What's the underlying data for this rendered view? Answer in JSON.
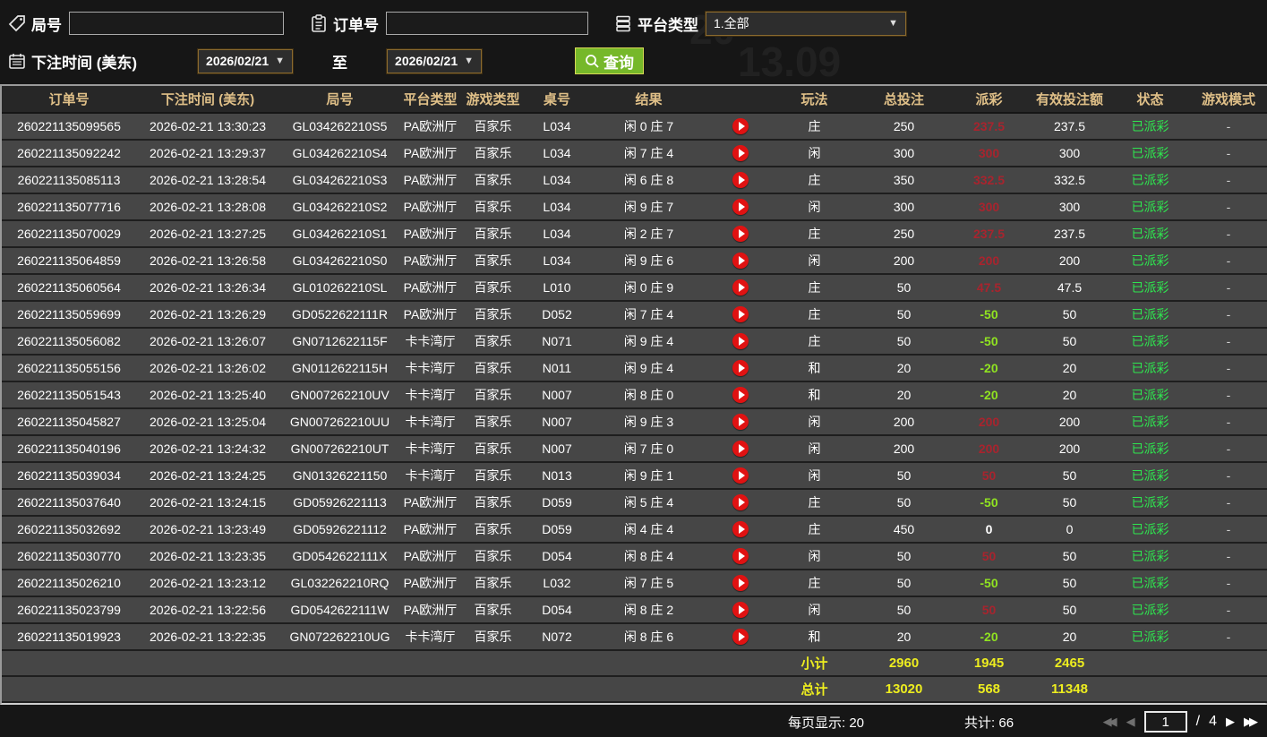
{
  "watermark": {
    "part1": "20",
    "part2": "13.09"
  },
  "filters": {
    "game_no_label": "局号",
    "order_no_label": "订单号",
    "platform_label": "平台类型",
    "platform_value": "1.全部",
    "bet_time_label": "下注时间 (美东)",
    "date_from": "2026/02/21",
    "to_label": "至",
    "date_to": "2026/02/21",
    "query_label": "查询",
    "caret": "▼"
  },
  "colors": {
    "payout_win": "#a8242e",
    "payout_loss": "#90e321",
    "status_paid_green": "#2ee64f",
    "summary_yellow": "#eded1f",
    "header_gold": "#e0c088",
    "query_button_green": "#76b82a",
    "play_icon_red": "#e01212"
  },
  "table": {
    "columns": [
      "订单号",
      "下注时间 (美东)",
      "局号",
      "平台类型",
      "游戏类型",
      "桌号",
      "结果",
      "",
      "玩法",
      "总投注",
      "派彩",
      "有效投注额",
      "状态",
      "游戏模式"
    ],
    "rows": [
      {
        "order": "260221135099565",
        "time": "2026-02-21 13:30:23",
        "game_no": "GL034262210S5",
        "platform": "PA欧洲厅",
        "game_type": "百家乐",
        "table_no": "L034",
        "result": "闲 0 庄 7",
        "bet_type": "庄",
        "total_bet": "250",
        "payout": "237.5",
        "payout_sign": "pos",
        "valid_bet": "237.5",
        "status": "已派彩",
        "mode": "-"
      },
      {
        "order": "260221135092242",
        "time": "2026-02-21 13:29:37",
        "game_no": "GL034262210S4",
        "platform": "PA欧洲厅",
        "game_type": "百家乐",
        "table_no": "L034",
        "result": "闲 7 庄 4",
        "bet_type": "闲",
        "total_bet": "300",
        "payout": "300",
        "payout_sign": "pos",
        "valid_bet": "300",
        "status": "已派彩",
        "mode": "-"
      },
      {
        "order": "260221135085113",
        "time": "2026-02-21 13:28:54",
        "game_no": "GL034262210S3",
        "platform": "PA欧洲厅",
        "game_type": "百家乐",
        "table_no": "L034",
        "result": "闲 6 庄 8",
        "bet_type": "庄",
        "total_bet": "350",
        "payout": "332.5",
        "payout_sign": "pos",
        "valid_bet": "332.5",
        "status": "已派彩",
        "mode": "-"
      },
      {
        "order": "260221135077716",
        "time": "2026-02-21 13:28:08",
        "game_no": "GL034262210S2",
        "platform": "PA欧洲厅",
        "game_type": "百家乐",
        "table_no": "L034",
        "result": "闲 9 庄 7",
        "bet_type": "闲",
        "total_bet": "300",
        "payout": "300",
        "payout_sign": "pos",
        "valid_bet": "300",
        "status": "已派彩",
        "mode": "-"
      },
      {
        "order": "260221135070029",
        "time": "2026-02-21 13:27:25",
        "game_no": "GL034262210S1",
        "platform": "PA欧洲厅",
        "game_type": "百家乐",
        "table_no": "L034",
        "result": "闲 2 庄 7",
        "bet_type": "庄",
        "total_bet": "250",
        "payout": "237.5",
        "payout_sign": "pos",
        "valid_bet": "237.5",
        "status": "已派彩",
        "mode": "-"
      },
      {
        "order": "260221135064859",
        "time": "2026-02-21 13:26:58",
        "game_no": "GL034262210S0",
        "platform": "PA欧洲厅",
        "game_type": "百家乐",
        "table_no": "L034",
        "result": "闲 9 庄 6",
        "bet_type": "闲",
        "total_bet": "200",
        "payout": "200",
        "payout_sign": "pos",
        "valid_bet": "200",
        "status": "已派彩",
        "mode": "-"
      },
      {
        "order": "260221135060564",
        "time": "2026-02-21 13:26:34",
        "game_no": "GL010262210SL",
        "platform": "PA欧洲厅",
        "game_type": "百家乐",
        "table_no": "L010",
        "result": "闲 0 庄 9",
        "bet_type": "庄",
        "total_bet": "50",
        "payout": "47.5",
        "payout_sign": "pos",
        "valid_bet": "47.5",
        "status": "已派彩",
        "mode": "-"
      },
      {
        "order": "260221135059699",
        "time": "2026-02-21 13:26:29",
        "game_no": "GD0522622111R",
        "platform": "PA欧洲厅",
        "game_type": "百家乐",
        "table_no": "D052",
        "result": "闲 7 庄 4",
        "bet_type": "庄",
        "total_bet": "50",
        "payout": "-50",
        "payout_sign": "neg",
        "valid_bet": "50",
        "status": "已派彩",
        "mode": "-"
      },
      {
        "order": "260221135056082",
        "time": "2026-02-21 13:26:07",
        "game_no": "GN0712622115F",
        "platform": "卡卡湾厅",
        "game_type": "百家乐",
        "table_no": "N071",
        "result": "闲 9 庄 4",
        "bet_type": "庄",
        "total_bet": "50",
        "payout": "-50",
        "payout_sign": "neg",
        "valid_bet": "50",
        "status": "已派彩",
        "mode": "-"
      },
      {
        "order": "260221135055156",
        "time": "2026-02-21 13:26:02",
        "game_no": "GN0112622115H",
        "platform": "卡卡湾厅",
        "game_type": "百家乐",
        "table_no": "N011",
        "result": "闲 9 庄 4",
        "bet_type": "和",
        "total_bet": "20",
        "payout": "-20",
        "payout_sign": "neg",
        "valid_bet": "20",
        "status": "已派彩",
        "mode": "-"
      },
      {
        "order": "260221135051543",
        "time": "2026-02-21 13:25:40",
        "game_no": "GN007262210UV",
        "platform": "卡卡湾厅",
        "game_type": "百家乐",
        "table_no": "N007",
        "result": "闲 8 庄 0",
        "bet_type": "和",
        "total_bet": "20",
        "payout": "-20",
        "payout_sign": "neg",
        "valid_bet": "20",
        "status": "已派彩",
        "mode": "-"
      },
      {
        "order": "260221135045827",
        "time": "2026-02-21 13:25:04",
        "game_no": "GN007262210UU",
        "platform": "卡卡湾厅",
        "game_type": "百家乐",
        "table_no": "N007",
        "result": "闲 9 庄 3",
        "bet_type": "闲",
        "total_bet": "200",
        "payout": "200",
        "payout_sign": "pos",
        "valid_bet": "200",
        "status": "已派彩",
        "mode": "-"
      },
      {
        "order": "260221135040196",
        "time": "2026-02-21 13:24:32",
        "game_no": "GN007262210UT",
        "platform": "卡卡湾厅",
        "game_type": "百家乐",
        "table_no": "N007",
        "result": "闲 7 庄 0",
        "bet_type": "闲",
        "total_bet": "200",
        "payout": "200",
        "payout_sign": "pos",
        "valid_bet": "200",
        "status": "已派彩",
        "mode": "-"
      },
      {
        "order": "260221135039034",
        "time": "2026-02-21 13:24:25",
        "game_no": "GN01326221150",
        "platform": "卡卡湾厅",
        "game_type": "百家乐",
        "table_no": "N013",
        "result": "闲 9 庄 1",
        "bet_type": "闲",
        "total_bet": "50",
        "payout": "50",
        "payout_sign": "pos",
        "valid_bet": "50",
        "status": "已派彩",
        "mode": "-"
      },
      {
        "order": "260221135037640",
        "time": "2026-02-21 13:24:15",
        "game_no": "GD05926221113",
        "platform": "PA欧洲厅",
        "game_type": "百家乐",
        "table_no": "D059",
        "result": "闲 5 庄 4",
        "bet_type": "庄",
        "total_bet": "50",
        "payout": "-50",
        "payout_sign": "neg",
        "valid_bet": "50",
        "status": "已派彩",
        "mode": "-"
      },
      {
        "order": "260221135032692",
        "time": "2026-02-21 13:23:49",
        "game_no": "GD05926221112",
        "platform": "PA欧洲厅",
        "game_type": "百家乐",
        "table_no": "D059",
        "result": "闲 4 庄 4",
        "bet_type": "庄",
        "total_bet": "450",
        "payout": "0",
        "payout_sign": "zero",
        "valid_bet": "0",
        "status": "已派彩",
        "mode": "-"
      },
      {
        "order": "260221135030770",
        "time": "2026-02-21 13:23:35",
        "game_no": "GD0542622111X",
        "platform": "PA欧洲厅",
        "game_type": "百家乐",
        "table_no": "D054",
        "result": "闲 8 庄 4",
        "bet_type": "闲",
        "total_bet": "50",
        "payout": "50",
        "payout_sign": "pos",
        "valid_bet": "50",
        "status": "已派彩",
        "mode": "-"
      },
      {
        "order": "260221135026210",
        "time": "2026-02-21 13:23:12",
        "game_no": "GL032262210RQ",
        "platform": "PA欧洲厅",
        "game_type": "百家乐",
        "table_no": "L032",
        "result": "闲 7 庄 5",
        "bet_type": "庄",
        "total_bet": "50",
        "payout": "-50",
        "payout_sign": "neg",
        "valid_bet": "50",
        "status": "已派彩",
        "mode": "-"
      },
      {
        "order": "260221135023799",
        "time": "2026-02-21 13:22:56",
        "game_no": "GD0542622111W",
        "platform": "PA欧洲厅",
        "game_type": "百家乐",
        "table_no": "D054",
        "result": "闲 8 庄 2",
        "bet_type": "闲",
        "total_bet": "50",
        "payout": "50",
        "payout_sign": "pos",
        "valid_bet": "50",
        "status": "已派彩",
        "mode": "-"
      },
      {
        "order": "260221135019923",
        "time": "2026-02-21 13:22:35",
        "game_no": "GN072262210UG",
        "platform": "卡卡湾厅",
        "game_type": "百家乐",
        "table_no": "N072",
        "result": "闲 8 庄 6",
        "bet_type": "和",
        "total_bet": "20",
        "payout": "-20",
        "payout_sign": "neg",
        "valid_bet": "20",
        "status": "已派彩",
        "mode": "-"
      }
    ]
  },
  "summary": {
    "subtotal_label": "小计",
    "subtotal_total_bet": "2960",
    "subtotal_payout": "1945",
    "subtotal_valid_bet": "2465",
    "total_label": "总计",
    "total_total_bet": "13020",
    "total_payout": "568",
    "total_valid_bet": "11348"
  },
  "footer": {
    "per_page_text": "每页显示: 20",
    "grand_total_text": "共计: 66",
    "page_value": "1",
    "page_sep": "/",
    "total_pages": "4",
    "first_icon": "◀◀",
    "prev_icon": "◀",
    "next_icon": "▶",
    "last_icon": "▶▶"
  }
}
